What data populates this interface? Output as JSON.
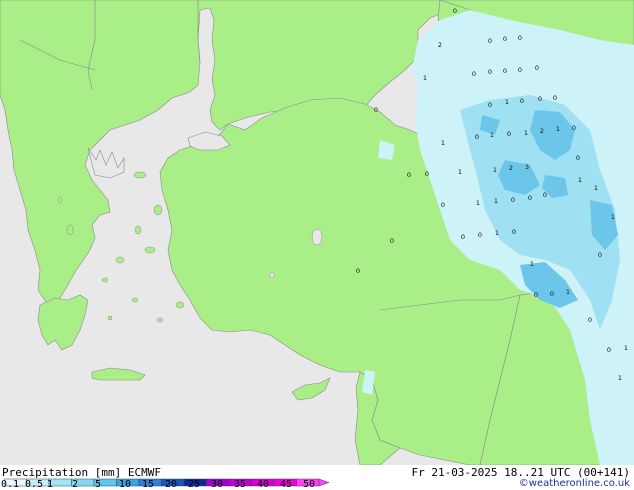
{
  "map": {
    "precip_labels": [
      {
        "t": "0"
      },
      {
        "t": "2"
      },
      {
        "t": "0"
      },
      {
        "t": "0"
      },
      {
        "t": "0"
      },
      {
        "t": "1"
      },
      {
        "t": "0"
      },
      {
        "t": "0"
      },
      {
        "t": "0"
      },
      {
        "t": "0"
      },
      {
        "t": "0"
      },
      {
        "t": "0"
      },
      {
        "t": "1"
      },
      {
        "t": "0"
      },
      {
        "t": "0"
      },
      {
        "t": "0"
      },
      {
        "t": "0"
      },
      {
        "t": "0"
      },
      {
        "t": "1"
      },
      {
        "t": "0"
      },
      {
        "t": "1"
      },
      {
        "t": "2"
      },
      {
        "t": "1"
      },
      {
        "t": "1"
      },
      {
        "t": "0"
      },
      {
        "t": "0"
      },
      {
        "t": "1"
      },
      {
        "t": "2"
      },
      {
        "t": "3"
      },
      {
        "t": "0"
      },
      {
        "t": "1"
      },
      {
        "t": "0"
      },
      {
        "t": "0"
      },
      {
        "t": "1"
      },
      {
        "t": "1"
      },
      {
        "t": "0"
      },
      {
        "t": "0"
      },
      {
        "t": "1"
      },
      {
        "t": "0"
      },
      {
        "t": "1"
      },
      {
        "t": "0"
      },
      {
        "t": "0"
      },
      {
        "t": "1"
      },
      {
        "t": "0"
      },
      {
        "t": "0"
      },
      {
        "t": "1"
      },
      {
        "t": "0"
      },
      {
        "t": "0"
      },
      {
        "t": "0"
      },
      {
        "t": "0"
      },
      {
        "t": "1"
      },
      {
        "t": "0"
      },
      {
        "t": "0"
      },
      {
        "t": "1"
      },
      {
        "t": "1"
      },
      {
        "t": "1"
      }
    ]
  },
  "legend": {
    "title": "Precipitation [mm]  ECMWF",
    "ticks": [
      "0.1",
      "0.5",
      "1",
      "2",
      "5",
      "10",
      "15",
      "20",
      "25",
      "30",
      "35",
      "40",
      "45",
      "50"
    ],
    "colors": [
      "#e8f8ff",
      "#c0f0ff",
      "#a0e6fa",
      "#80daf5",
      "#5cc8f0",
      "#38a4e6",
      "#2c80dc",
      "#1c54c4",
      "#0c2898",
      "#a000d0",
      "#c000d8",
      "#d800d8",
      "#f000e0",
      "#ff40ff"
    ]
  },
  "footer": {
    "valid_time": "Fr 21-03-2025 18..21 UTC (00+141)",
    "credit": "©weatheronline.co.uk"
  },
  "colors": {
    "land": "#aaee88",
    "sea": "#e8e8e8",
    "border": "#888888",
    "precip_light": "#cdf2f8",
    "precip_mid": "#9fe0f2",
    "precip_heavy": "#6cc6ea"
  }
}
